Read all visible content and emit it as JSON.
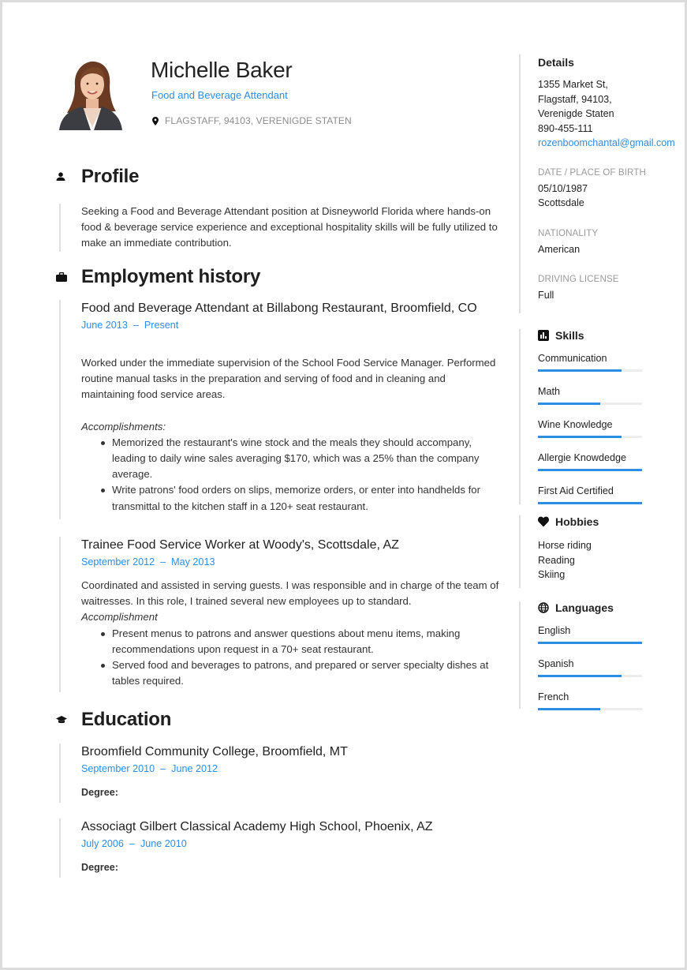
{
  "header": {
    "name": "Michelle Baker",
    "job_title": "Food and Beverage Attendant",
    "location": "FLAGSTAFF, 94103, VERENIGDE STATEN",
    "photo_alt": "Profile photo of Michelle Baker"
  },
  "profile": {
    "heading": "Profile",
    "text": "Seeking a Food and Beverage Attendant position at Disneyworld Florida where hands-on food & beverage service experience and exceptional hospitality skills will be fully utilized to make an immediate contribution."
  },
  "employment": {
    "heading": "Employment history",
    "jobs": [
      {
        "title": "Food and Beverage Attendant at Billabong Restaurant, Broomfield, CO",
        "start": "June 2013",
        "end": "Present",
        "description": "Worked under the immediate supervision of the School Food Service Manager. Performed routine manual tasks in the preparation and serving of food and in cleaning and maintaining food service areas.",
        "accomplishments_label": "Accomplishments:",
        "bullets": [
          "Memorized the restaurant's wine stock and the meals they should accompany, leading to daily wine sales averaging $170, which was a 25% than the company average.",
          "Write patrons' food orders on slips, memorize orders, or enter into handhelds for transmittal to the kitchen staff in a 120+ seat restaurant."
        ]
      },
      {
        "title": "Trainee Food Service Worker at Woody's, Scottsdale, AZ",
        "start": "September 2012",
        "end": "May 2013",
        "description": "Coordinated and assisted in serving guests. I was responsible and in charge of the team of waitresses. In this role, I trained several new employees up to standard.",
        "accomplishments_label": "Accomplishment",
        "bullets": [
          "Present menus to patrons and answer questions about menu items, making recommendations upon request in a 70+ seat restaurant.",
          "Served food and beverages to patrons, and prepared or server specialty dishes at tables required."
        ]
      }
    ]
  },
  "education": {
    "heading": "Education",
    "schools": [
      {
        "title": "Broomfield Community College, Broomfield, MT",
        "start": "September 2010",
        "end": "June 2012",
        "degree_label": "Degree:"
      },
      {
        "title": "Associagt Gilbert Classical Academy High School, Phoenix, AZ",
        "start": "July 2006",
        "end": "June 2010",
        "degree_label": "Degree:"
      }
    ]
  },
  "date_separator": "–",
  "sidebar": {
    "details": {
      "heading": "Details",
      "address_lines": [
        "1355 Market St,",
        "Flagstaff, 94103,",
        "Verenigde Staten"
      ],
      "phone": "890-455-111",
      "email": "rozenboomchantal@gmail.com"
    },
    "birth": {
      "label": "DATE / PLACE OF BIRTH",
      "date": "05/10/1987",
      "place": "Scottsdale"
    },
    "nationality": {
      "label": "NATIONALITY",
      "value": "American"
    },
    "driving": {
      "label": "DRIVING LICENSE",
      "value": "Full"
    },
    "skills": {
      "heading": "Skills",
      "items": [
        {
          "name": "Communication",
          "level": 0.8
        },
        {
          "name": "Math",
          "level": 0.6
        },
        {
          "name": "Wine Knowledge",
          "level": 0.8
        },
        {
          "name": "Allergie Knowdedge",
          "level": 1.0
        },
        {
          "name": "First Aid Certified",
          "level": 1.0
        }
      ]
    },
    "hobbies": {
      "heading": "Hobbies",
      "items": [
        "Horse riding",
        "Reading",
        "Skiing"
      ]
    },
    "languages": {
      "heading": "Languages",
      "items": [
        {
          "name": "English",
          "level": 1.0
        },
        {
          "name": "Spanish",
          "level": 0.8
        },
        {
          "name": "French",
          "level": 0.6
        }
      ]
    }
  },
  "colors": {
    "accent": "#2d8ee6",
    "text": "#222222",
    "muted": "#9a9a9a",
    "rule": "#e0e0e0",
    "bar_track": "#ededed"
  }
}
